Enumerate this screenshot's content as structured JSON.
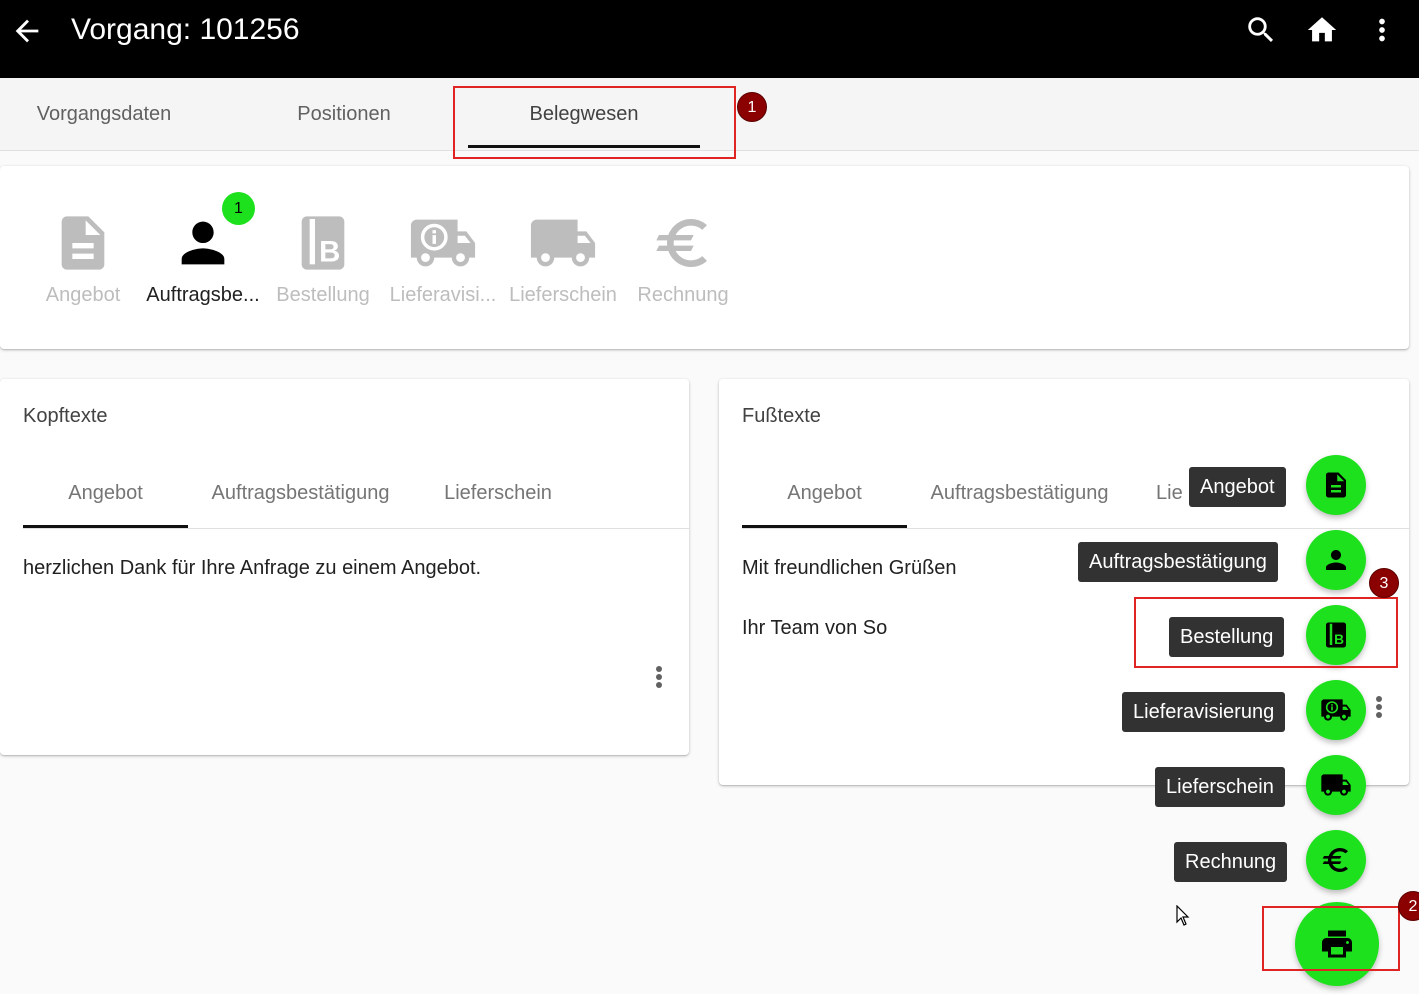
{
  "appbar": {
    "title": "Vorgang: 101256",
    "icons": [
      "arrow-back-icon",
      "search-icon",
      "home-icon",
      "more-vert-icon"
    ]
  },
  "main_tabs": [
    {
      "label": "Vorgangsdaten",
      "active": false
    },
    {
      "label": "Positionen",
      "active": false
    },
    {
      "label": "Belegwesen",
      "active": true
    }
  ],
  "documents": {
    "items": [
      {
        "label": "Angebot",
        "icon": "document-icon",
        "active": false
      },
      {
        "label": "Auftragsbe...",
        "icon": "person-icon",
        "active": true,
        "badge": "1"
      },
      {
        "label": "Bestellung",
        "icon": "order-b-icon",
        "active": false
      },
      {
        "label": "Lieferavisi...",
        "icon": "delivery-info-icon",
        "active": false
      },
      {
        "label": "Lieferschein",
        "icon": "truck-icon",
        "active": false
      },
      {
        "label": "Rechnung",
        "icon": "euro-icon",
        "active": false
      }
    ]
  },
  "kopftexte": {
    "title": "Kopftexte",
    "tabs": [
      "Angebot",
      "Auftragsbestätigung",
      "Lieferschein"
    ],
    "active_tab": 0,
    "text": "herzlichen Dank für Ihre Anfrage zu einem Angebot."
  },
  "fusstexte": {
    "title": "Fußtexte",
    "tabs": [
      "Angebot",
      "Auftragsbestätigung",
      "Lie"
    ],
    "active_tab": 0,
    "lines": [
      "Mit freundlichen Grüßen",
      "Ihr Team von So"
    ]
  },
  "speed_dial": {
    "actions": [
      {
        "label": "Angebot",
        "icon": "document-icon"
      },
      {
        "label": "Auftragsbestätigung",
        "icon": "person-icon"
      },
      {
        "label": "Bestellung",
        "icon": "order-b-icon"
      },
      {
        "label": "Lieferavisierung",
        "icon": "delivery-info-icon"
      },
      {
        "label": "Lieferschein",
        "icon": "truck-icon"
      },
      {
        "label": "Rechnung",
        "icon": "euro-icon"
      }
    ],
    "main_icon": "print-icon"
  },
  "annotations": [
    "1",
    "2",
    "3"
  ],
  "colors": {
    "appbar": "#000000",
    "fab": "#1ee11e",
    "badge": "#1ee11e",
    "annotation_marker": "#8b0000",
    "annotation_box": "#e02424",
    "tooltip": "#323232",
    "inactive_icon": "#bdbdbd"
  }
}
